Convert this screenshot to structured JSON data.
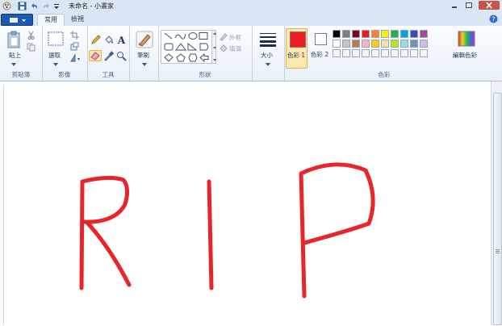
{
  "window": {
    "title": "未命名 - 小畫家"
  },
  "tabs": {
    "home": "常用",
    "view": "檢視"
  },
  "clipboard": {
    "paste": "貼上",
    "group": "剪貼簿"
  },
  "image": {
    "select": "選取",
    "group": "影像"
  },
  "tools": {
    "group": "工具"
  },
  "brushes": {
    "label": "筆刷"
  },
  "shapes": {
    "outline": "外框",
    "fill": "填滿",
    "group": "形狀"
  },
  "size": {
    "label": "大小"
  },
  "colors": {
    "color1_label": "色彩 1",
    "color2_label": "色彩 2",
    "edit_label": "編輯色彩",
    "group": "色彩",
    "color1": "#ee1d24",
    "color2": "#ffffff",
    "palette_row1": [
      "#000000",
      "#7f7f7f",
      "#880015",
      "#ed1c24",
      "#ff7f27",
      "#fff200",
      "#22b14c",
      "#00a2e8",
      "#3f48cc",
      "#a349a4"
    ],
    "palette_row2": [
      "#ffffff",
      "#c3c3c3",
      "#b97a57",
      "#ffaec9",
      "#ffc90e",
      "#efe4b0",
      "#b5e61d",
      "#99d9ea",
      "#7092be",
      "#c8bfe7"
    ],
    "palette_row3_count": 10
  },
  "drawing": {
    "ink_color": "#e8262a",
    "letters": [
      "R",
      "I",
      "P"
    ]
  },
  "icons": [
    "paint-app-icon",
    "save-icon",
    "undo-icon",
    "redo-icon",
    "help-icon",
    "paste-icon",
    "cut-icon",
    "copy-icon",
    "select-icon",
    "crop-icon",
    "resize-icon",
    "rotate-icon",
    "pencil-icon",
    "fill-icon",
    "text-icon",
    "eraser-icon",
    "color-picker-icon",
    "magnifier-icon",
    "brush-icon",
    "size-icon",
    "edit-colors-icon"
  ]
}
